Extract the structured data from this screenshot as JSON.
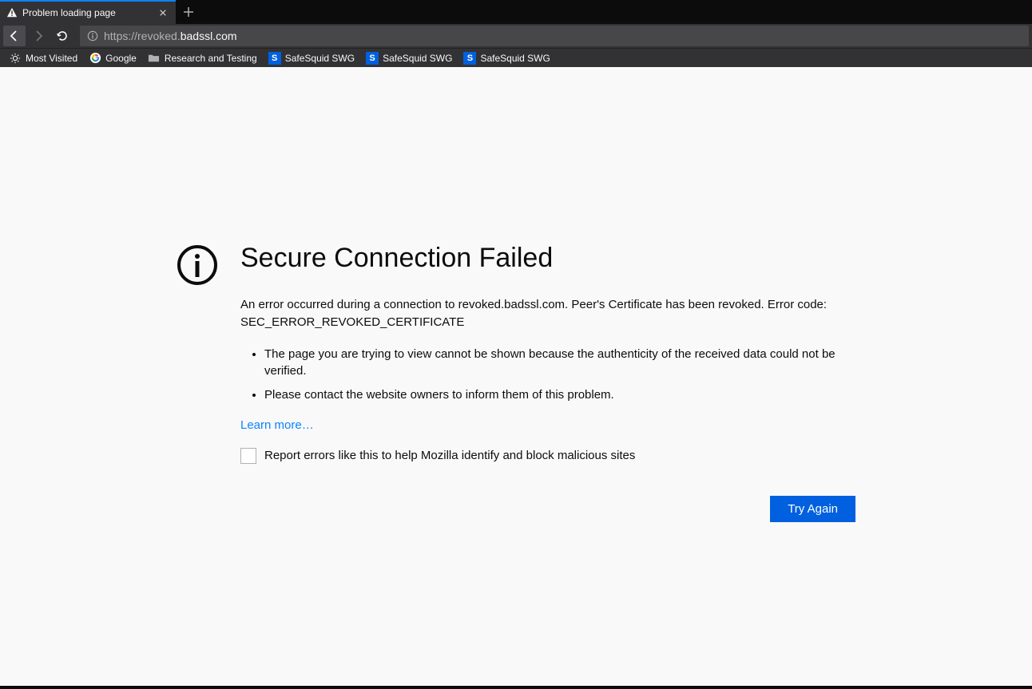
{
  "tab": {
    "title": "Problem loading page"
  },
  "url": {
    "prefix": "https://revoked.",
    "host": "badssl.com"
  },
  "bookmarks": [
    {
      "type": "gear",
      "label": "Most Visited"
    },
    {
      "type": "google",
      "label": "Google"
    },
    {
      "type": "folder",
      "label": "Research and Testing"
    },
    {
      "type": "s",
      "label": "SafeSquid SWG"
    },
    {
      "type": "s",
      "label": "SafeSquid SWG"
    },
    {
      "type": "s",
      "label": "SafeSquid SWG"
    }
  ],
  "error": {
    "title": "Secure Connection Failed",
    "desc1": "An error occurred during a connection to revoked.badssl.com. Peer's Certificate has been revoked. Error code: SEC_ERROR_REVOKED_CERTIFICATE",
    "bullet1": "The page you are trying to view cannot be shown because the authenticity of the received data could not be verified.",
    "bullet2": "Please contact the website owners to inform them of this problem.",
    "learn_more": "Learn more…",
    "report": "Report errors like this to help Mozilla identify and block malicious sites",
    "try_again": "Try Again"
  }
}
